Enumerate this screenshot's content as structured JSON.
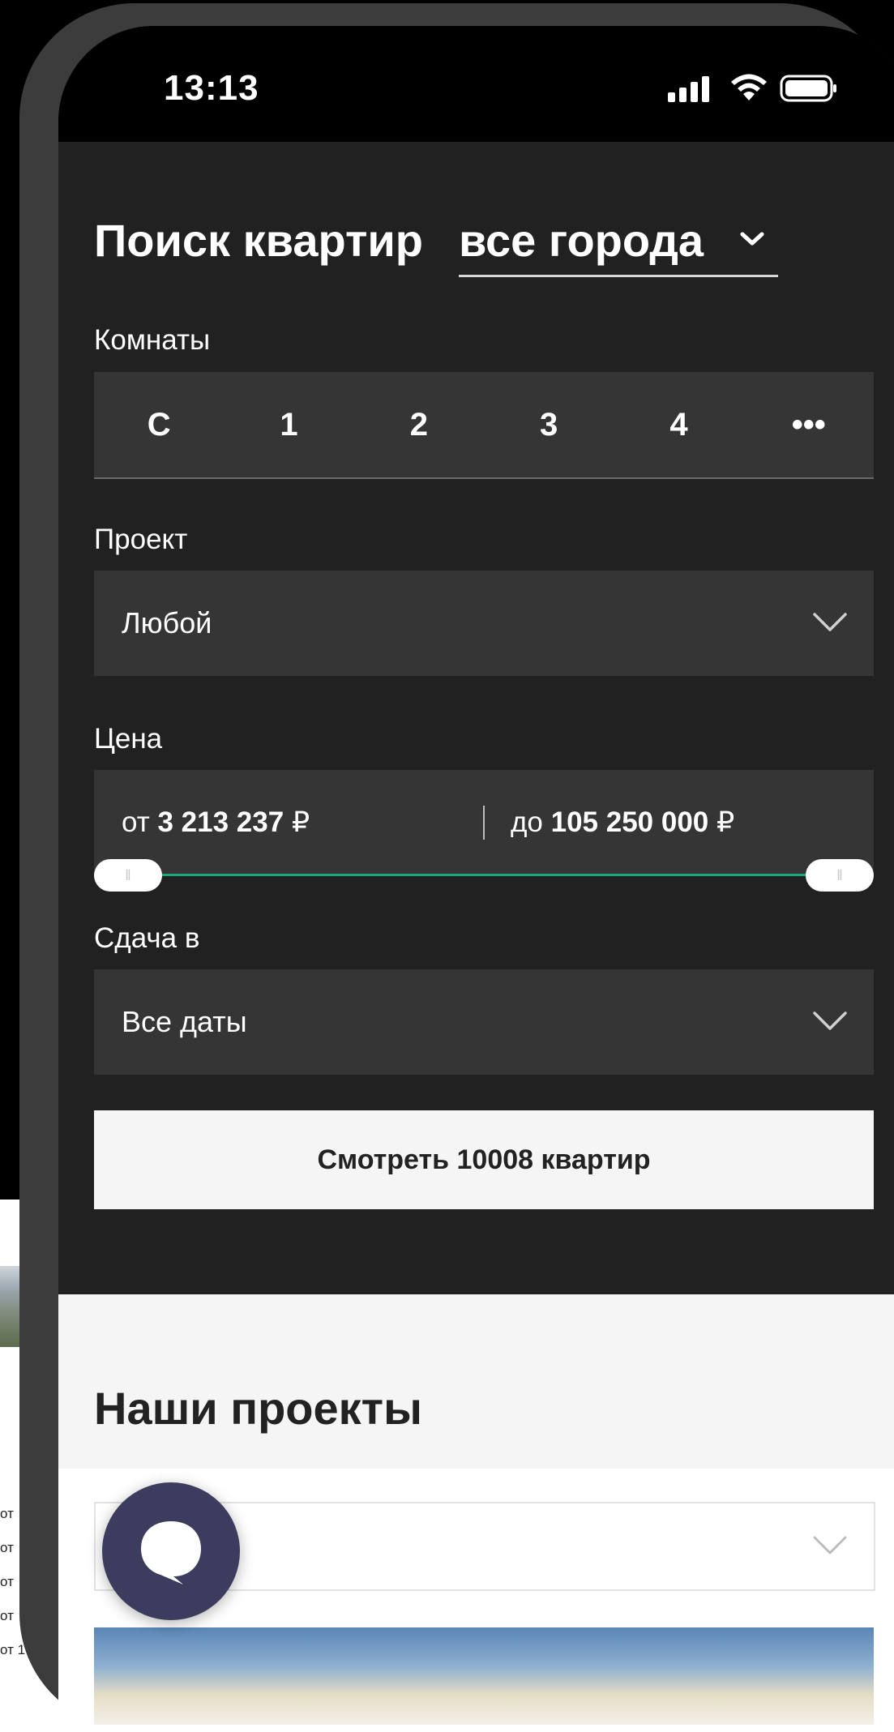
{
  "status_bar": {
    "time": "13:13"
  },
  "search": {
    "title": "Поиск квартир",
    "city": "все города",
    "rooms": {
      "label": "Комнаты",
      "options": [
        "С",
        "1",
        "2",
        "3",
        "4",
        "•••"
      ]
    },
    "project": {
      "label": "Проект",
      "value": "Любой"
    },
    "price": {
      "label": "Цена",
      "from_prefix": "от",
      "from_value": "3 213 237",
      "to_prefix": "до",
      "to_value": "105 250 000",
      "currency": "₽",
      "range_fraction": [
        0.0,
        1.0
      ]
    },
    "delivery": {
      "label": "Сдача в",
      "value": "Все даты"
    },
    "show_button": "Смотреть 10008 квартир"
  },
  "projects": {
    "title": "Наши проекты"
  },
  "background_side_labels": [
    "от",
    "от",
    "от",
    "от",
    "от 1"
  ],
  "colors": {
    "accent": "#19a77d",
    "panel": "#212121",
    "field": "#353535",
    "chat": "#3c3c5e"
  }
}
